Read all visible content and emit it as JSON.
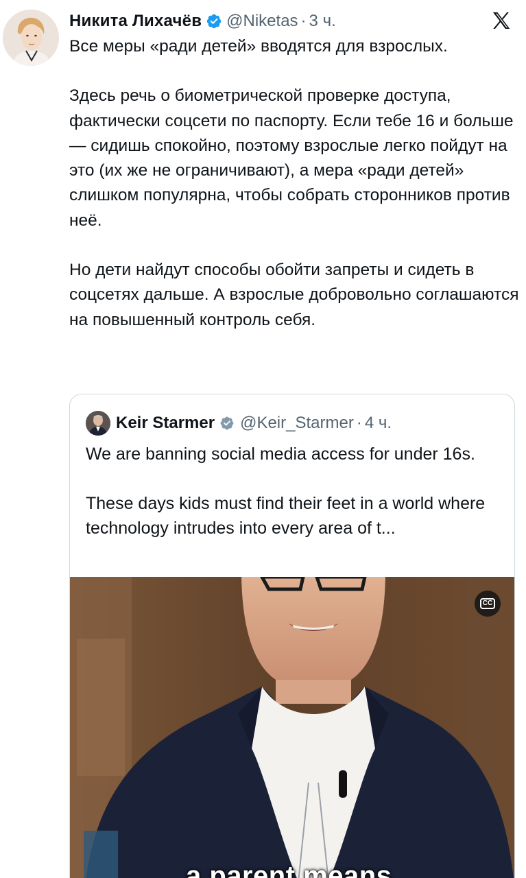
{
  "tweet": {
    "author": {
      "name": "Никита Лихачёв",
      "handle": "@Niketas",
      "time": "3 ч.",
      "verified": true
    },
    "text": [
      "Все меры «ради детей» вводятся для взрослых.",
      "Здесь речь о биометрической проверке доступа, фактически соцсети по паспорту. Если тебе 16 и больше — сидишь спокойно, поэтому взрослые легко пойдут на это (их же не ограничивают), а мера «ради детей» слишком популярна, чтобы собрать сторонников против неё.",
      "Но дети найдут способы обойти запреты и сидеть в соцсетях дальше. А взрослые добровольно соглашаются на повышенный контроль себя."
    ]
  },
  "quote": {
    "author": {
      "name": "Keir Starmer",
      "handle": "@Keir_Starmer",
      "time": "4 ч.",
      "verified": true
    },
    "text": [
      "We are banning social media access for under 16s.",
      "These days kids must find their feet in a world where technology intrudes into every area of t..."
    ],
    "video": {
      "caption": "a parent means.",
      "cc_label": "CC"
    }
  },
  "icons": {
    "verified": "verified-badge-icon",
    "platform": "x-logo-icon",
    "cc": "closed-captions-icon"
  },
  "colors": {
    "verified_blue": "#1d9bf0",
    "text": "#0f1419",
    "muted": "#536471",
    "border": "#cfd9de",
    "quote_verified_gray": "#829aab"
  }
}
